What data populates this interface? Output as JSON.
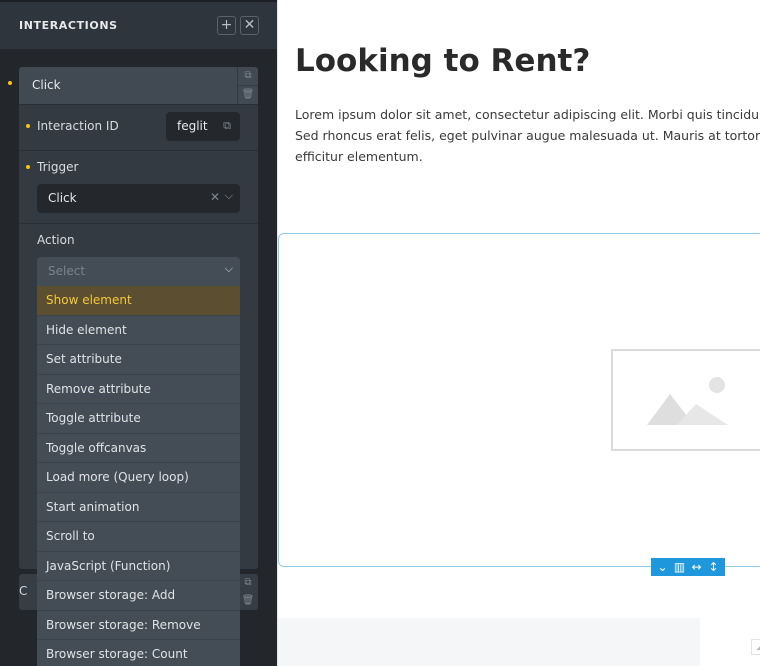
{
  "sidebar": {
    "title": "INTERACTIONS",
    "add_icon": "plus-icon",
    "close_icon": "close-icon",
    "interactions": [
      {
        "label": "Click",
        "fields": {
          "interaction_id_label": "Interaction ID",
          "interaction_id_value": "feglit",
          "trigger_label": "Trigger",
          "trigger_value": "Click",
          "action_label": "Action",
          "action_placeholder": "Select"
        }
      },
      {
        "label": "C"
      }
    ],
    "action_options": [
      "Show element",
      "Hide element",
      "Set attribute",
      "Remove attribute",
      "Toggle attribute",
      "Toggle offcanvas",
      "Load more (Query loop)",
      "Start animation",
      "Scroll to",
      "JavaScript (Function)",
      "Browser storage: Add",
      "Browser storage: Remove",
      "Browser storage: Count"
    ],
    "highlighted_option": "Show element"
  },
  "canvas": {
    "heading": "Looking to Rent?",
    "body": "Lorem ipsum dolor sit amet, consectetur adipiscing elit. Morbi quis tincidunt dolor. Sed rhoncus erat felis, eget pulvinar augue malesuada ut. Mauris at tortor ut lacus efficitur elementum.",
    "image_placeholder_icon": "image-placeholder-icon",
    "toolbar_icons": [
      "chevron-down-icon",
      "columns-icon",
      "horizontal-resize-icon",
      "vertical-resize-icon"
    ]
  },
  "colors": {
    "accent_yellow": "#f3c93b",
    "highlight_bg": "#5c4f31",
    "selection_blue": "#1e97dc"
  }
}
